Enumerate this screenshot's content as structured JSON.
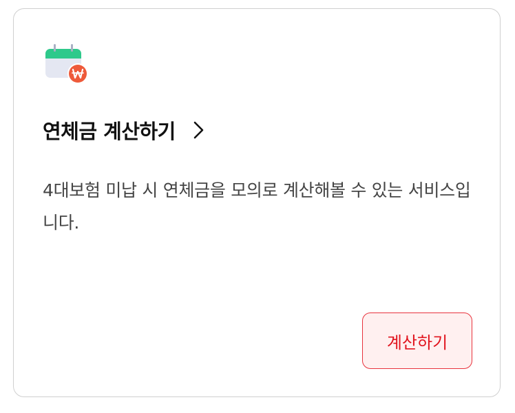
{
  "card": {
    "icon": "calendar-won-icon",
    "title": "연체금 계산하기",
    "chevron_icon": "chevron-right-icon",
    "description": "4대보험 미납 시 연체금을 모의로 계산해볼 수 있는 서비스입니다.",
    "button_label": "계산하기"
  },
  "colors": {
    "calendar_header": "#2ec98b",
    "calendar_body": "#e4e7f2",
    "won_badge": "#ee5a3a",
    "button_text": "#e1141e",
    "button_border": "#e8323c",
    "button_background": "#fff0f0"
  }
}
